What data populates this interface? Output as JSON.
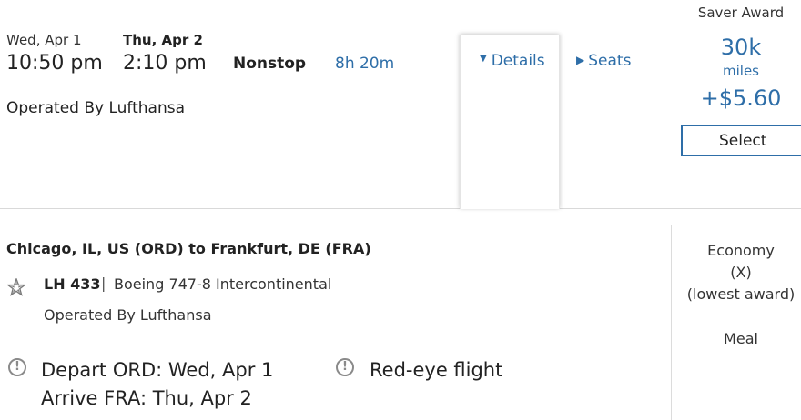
{
  "summary": {
    "depart_date": "Wed, Apr 1",
    "arrive_date": "Thu, Apr 2",
    "depart_time": "10:50 pm",
    "arrive_time": "2:10 pm",
    "stops": "Nonstop",
    "duration": "8h 20m",
    "operated_by": "Operated By Lufthansa",
    "details_link": "Details",
    "seats_link": "Seats"
  },
  "fare": {
    "label": "Saver Award",
    "miles": "30k",
    "miles_unit": "miles",
    "tax": "+$5.60",
    "select_label": "Select"
  },
  "segment": {
    "route": "Chicago, IL, US (ORD) to Frankfurt, DE (FRA)",
    "flight_number": "LH 433",
    "separator": "|",
    "aircraft": "Boeing 747-8 Intercontinental",
    "operated_by": "Operated By Lufthansa",
    "depart_note": "Depart ORD: Wed, Apr 1",
    "arrive_note": "Arrive FRA: Thu, Apr 2",
    "redeye_note": "Red-eye flight",
    "cabin": "Economy",
    "cabin_code": "(X)",
    "cabin_note": "(lowest award)",
    "meal": "Meal"
  },
  "icons": {
    "details_chevron": "chevron-down-icon",
    "seats_triangle": "triangle-right-icon",
    "star_alliance": "star-alliance-icon",
    "warning": "exclamation-circle-icon"
  },
  "colors": {
    "accent": "#2e6ea8",
    "text": "#222222",
    "icon_gray": "#8a8a8a"
  }
}
